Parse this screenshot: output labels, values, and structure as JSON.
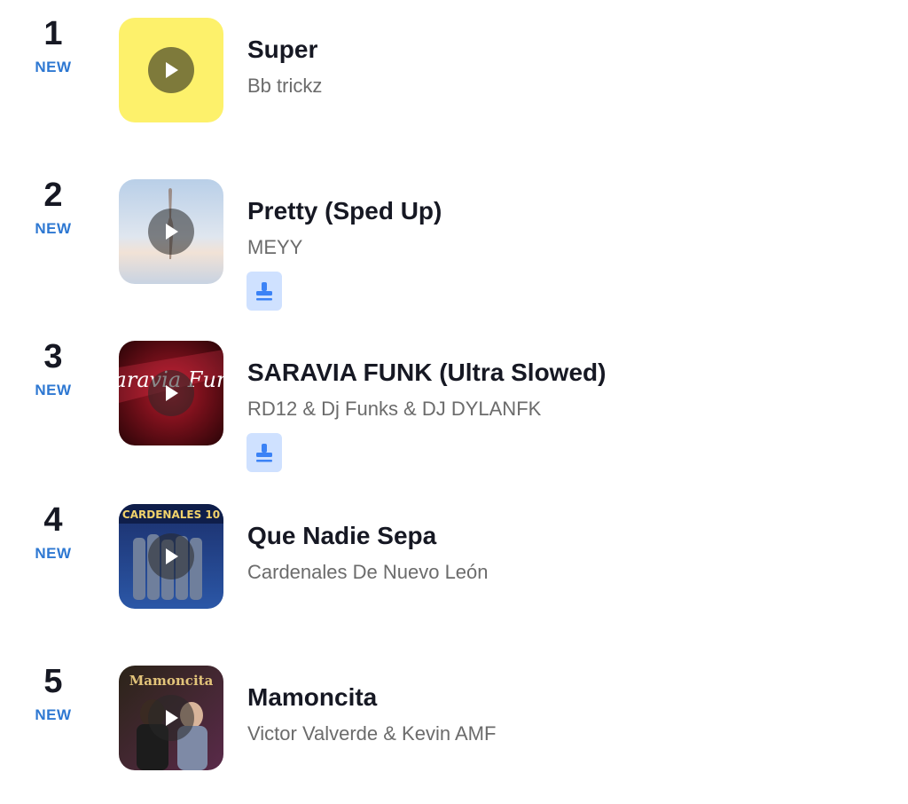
{
  "colors": {
    "new_badge": "#2e78d2",
    "title": "#161823",
    "artist": "#6b6b6b",
    "tag_bg": "#cfe1ff",
    "tag_fg": "#3b82f6",
    "cover_yellow": "#fdf16b"
  },
  "chart": {
    "items": [
      {
        "rank": "1",
        "badge": "NEW",
        "title": "Super",
        "artist": "Bb trickz",
        "cover": "yellow-placeholder",
        "has_tag_icon": false
      },
      {
        "rank": "2",
        "badge": "NEW",
        "title": "Pretty (Sped Up)",
        "artist": "MEYY",
        "cover": "dancer-sky",
        "has_tag_icon": true,
        "tag_icon": "stamp-icon"
      },
      {
        "rank": "3",
        "badge": "NEW",
        "title": "SARAVIA FUNK (Ultra Slowed)",
        "artist": "RD12 & Dj Funks & DJ DYLANFK",
        "cover": "saravia-funk",
        "cover_text": "Saravia Funk",
        "has_tag_icon": true,
        "tag_icon": "stamp-icon"
      },
      {
        "rank": "4",
        "badge": "NEW",
        "title": "Que Nadie Sepa",
        "artist": "Cardenales De Nuevo León",
        "cover": "cardenales-band",
        "cover_text": "CARDENALES 10",
        "has_tag_icon": false
      },
      {
        "rank": "5",
        "badge": "NEW",
        "title": "Mamoncita",
        "artist": "Victor Valverde & Kevin AMF",
        "cover": "mamoncita-duo",
        "cover_text": "Mamoncita",
        "has_tag_icon": false
      }
    ]
  }
}
